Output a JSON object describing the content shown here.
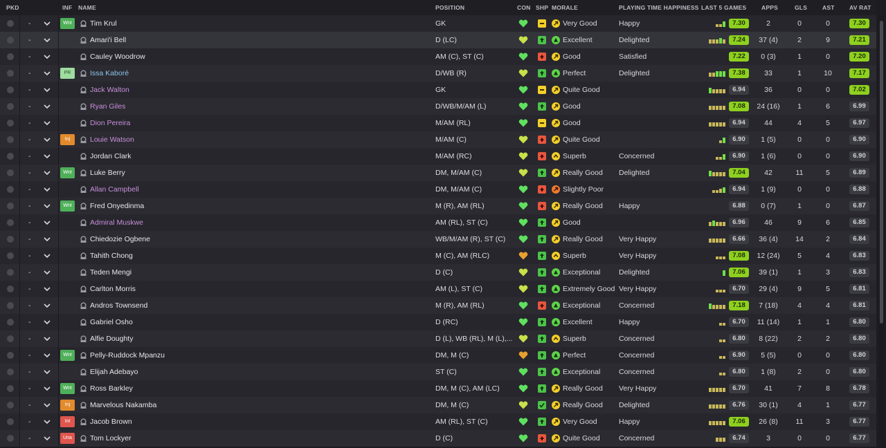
{
  "headers": {
    "pkd": "PKD",
    "inf": "INF",
    "name": "NAME",
    "position": "POSITION",
    "con": "CON",
    "shp": "SHP",
    "morale": "MORALE",
    "pth": "PLAYING TIME HAPPINESS",
    "last5": "LAST 5 GAMES",
    "apps": "APPS",
    "gls": "GLS",
    "ast": "AST",
    "avrat": "AV RAT"
  },
  "colors": {
    "rating_high": "#8ed01f",
    "rating_low": "#3b3b42",
    "heart_green": "#5fe05f",
    "heart_yellowgreen": "#c8e04a",
    "heart_orange": "#e8a030",
    "morale_good": "#f2cf2a",
    "morale_great": "#5fd34a",
    "morale_poor": "#f07a30",
    "inf_wnt": "#4fb05a",
    "inf_pr": "#9fdc9f",
    "inf_inj": "#e38a2c",
    "inf_int": "#e0564e"
  },
  "players": [
    {
      "pkd": "-",
      "inf": "Wnt",
      "name": "Tim Krul",
      "style": "normal",
      "pos": "GK",
      "con": "green",
      "shp": "yellow-dash",
      "morale_icon": "good",
      "morale": "Very Good",
      "pth": "Happy",
      "last5": [
        "short",
        "short",
        "tall"
      ],
      "last5_rating": "7.30",
      "last5_hi": true,
      "apps": "2",
      "gls": "0",
      "ast": "0",
      "avrat": "7.30",
      "avrat_hi": true
    },
    {
      "pkd": "-",
      "inf": "",
      "name": "Amari'i Bell",
      "style": "normal",
      "pos": "D (LC)",
      "con": "yellowgreen",
      "shp": "green-up",
      "morale_icon": "great",
      "morale": "Excellent",
      "pth": "Delighted",
      "last5": [
        "mid",
        "mid",
        "mid",
        "tall",
        "mid"
      ],
      "last5_rating": "7.24",
      "last5_hi": true,
      "apps": "37 (4)",
      "gls": "2",
      "ast": "9",
      "avrat": "7.21",
      "avrat_hi": true
    },
    {
      "pkd": "-",
      "inf": "",
      "name": "Cauley Woodrow",
      "style": "normal",
      "pos": "AM (C), ST (C)",
      "con": "green",
      "shp": "red-up",
      "morale_icon": "good",
      "morale": "Good",
      "pth": "Satisfied",
      "last5": [],
      "last5_rating": "7.22",
      "last5_hi": true,
      "apps": "0 (3)",
      "gls": "1",
      "ast": "0",
      "avrat": "7.20",
      "avrat_hi": true
    },
    {
      "pkd": "-",
      "inf": "PR",
      "name": "Issa Kaboré",
      "style": "blue",
      "pos": "D/WB (R)",
      "con": "yellowgreen",
      "shp": "green-up",
      "morale_icon": "great",
      "morale": "Perfect",
      "pth": "Delighted",
      "last5": [
        "mid",
        "mid",
        "tall",
        "tall",
        "tall"
      ],
      "last5_rating": "7.38",
      "last5_hi": true,
      "apps": "33",
      "gls": "1",
      "ast": "10",
      "avrat": "7.17",
      "avrat_hi": true
    },
    {
      "pkd": "-",
      "inf": "",
      "name": "Jack Walton",
      "style": "loan",
      "pos": "GK",
      "con": "green",
      "shp": "yellow-dash",
      "morale_icon": "good",
      "morale": "Quite Good",
      "pth": "",
      "last5": [
        "tall",
        "mid",
        "mid",
        "mid",
        "mid"
      ],
      "last5_rating": "6.94",
      "last5_hi": false,
      "apps": "36",
      "gls": "0",
      "ast": "0",
      "avrat": "7.02",
      "avrat_hi": true
    },
    {
      "pkd": "-",
      "inf": "",
      "name": "Ryan Giles",
      "style": "loan",
      "pos": "D/WB/M/AM (L)",
      "con": "green",
      "shp": "green-up",
      "morale_icon": "good",
      "morale": "Good",
      "pth": "",
      "last5": [
        "mid",
        "mid",
        "mid",
        "mid",
        "mid"
      ],
      "last5_rating": "7.08",
      "last5_hi": true,
      "apps": "24 (16)",
      "gls": "1",
      "ast": "6",
      "avrat": "6.99",
      "avrat_hi": false
    },
    {
      "pkd": "-",
      "inf": "",
      "name": "Dion Pereira",
      "style": "loan",
      "pos": "M/AM (RL)",
      "con": "green",
      "shp": "yellow-dash",
      "morale_icon": "good",
      "morale": "Good",
      "pth": "",
      "last5": [
        "mid",
        "mid",
        "mid",
        "mid",
        "mid"
      ],
      "last5_rating": "6.94",
      "last5_hi": false,
      "apps": "44",
      "gls": "4",
      "ast": "5",
      "avrat": "6.97",
      "avrat_hi": false
    },
    {
      "pkd": "-",
      "inf": "Inj",
      "name": "Louie Watson",
      "style": "loan",
      "pos": "M/AM (C)",
      "con": "yellowgreen",
      "shp": "red-up",
      "morale_icon": "good",
      "morale": "Quite Good",
      "pth": "",
      "last5": [
        "short",
        "tall"
      ],
      "last5_rating": "6.90",
      "last5_hi": false,
      "apps": "1 (5)",
      "gls": "0",
      "ast": "0",
      "avrat": "6.90",
      "avrat_hi": false
    },
    {
      "pkd": "-",
      "inf": "",
      "name": "Jordan Clark",
      "style": "normal",
      "pos": "M/AM (RC)",
      "con": "yellowgreen",
      "shp": "red-up",
      "morale_icon": "superb",
      "morale": "Superb",
      "pth": "Concerned",
      "last5": [
        "short",
        "short",
        "tall"
      ],
      "last5_rating": "6.90",
      "last5_hi": false,
      "apps": "1 (6)",
      "gls": "0",
      "ast": "0",
      "avrat": "6.90",
      "avrat_hi": false
    },
    {
      "pkd": "-",
      "inf": "Wnt",
      "name": "Luke Berry",
      "style": "normal",
      "pos": "DM, M/AM (C)",
      "con": "yellowgreen",
      "shp": "green-up",
      "morale_icon": "good",
      "morale": "Really Good",
      "pth": "Delighted",
      "last5": [
        "tall",
        "mid",
        "mid",
        "mid",
        "mid"
      ],
      "last5_rating": "7.04",
      "last5_hi": true,
      "apps": "42",
      "gls": "11",
      "ast": "5",
      "avrat": "6.89",
      "avrat_hi": false
    },
    {
      "pkd": "-",
      "inf": "",
      "name": "Allan Campbell",
      "style": "loan",
      "pos": "DM, M/AM (C)",
      "con": "green",
      "shp": "red-up",
      "morale_icon": "poor",
      "morale": "Slightly Poor",
      "pth": "",
      "last5": [
        "short",
        "short",
        "mid",
        "tall"
      ],
      "last5_rating": "6.94",
      "last5_hi": false,
      "apps": "1 (9)",
      "gls": "0",
      "ast": "0",
      "avrat": "6.88",
      "avrat_hi": false
    },
    {
      "pkd": "-",
      "inf": "Wnt",
      "name": "Fred Onyedinma",
      "style": "normal",
      "pos": "M (R), AM (RL)",
      "con": "green",
      "shp": "red-up",
      "morale_icon": "good",
      "morale": "Really Good",
      "pth": "Happy",
      "last5": [],
      "last5_rating": "6.88",
      "last5_hi": false,
      "apps": "0 (7)",
      "gls": "1",
      "ast": "0",
      "avrat": "6.87",
      "avrat_hi": false
    },
    {
      "pkd": "-",
      "inf": "",
      "name": "Admiral Muskwe",
      "style": "loan",
      "pos": "AM (RL), ST (C)",
      "con": "green",
      "shp": "green-up",
      "morale_icon": "good",
      "morale": "Good",
      "pth": "",
      "last5": [
        "mid",
        "tall",
        "mid",
        "mid",
        "mid"
      ],
      "last5_rating": "6.96",
      "last5_hi": false,
      "apps": "46",
      "gls": "9",
      "ast": "6",
      "avrat": "6.85",
      "avrat_hi": false
    },
    {
      "pkd": "-",
      "inf": "",
      "name": "Chiedozie Ogbene",
      "style": "normal",
      "pos": "WB/M/AM (R), ST (C)",
      "con": "green",
      "shp": "green-up",
      "morale_icon": "good",
      "morale": "Really Good",
      "pth": "Very Happy",
      "last5": [
        "mid",
        "mid",
        "mid",
        "mid",
        "mid"
      ],
      "last5_rating": "6.66",
      "last5_hi": false,
      "apps": "36 (4)",
      "gls": "14",
      "ast": "2",
      "avrat": "6.84",
      "avrat_hi": false
    },
    {
      "pkd": "-",
      "inf": "",
      "name": "Tahith Chong",
      "style": "normal",
      "pos": "M (C), AM (RLC)",
      "con": "orange",
      "shp": "green-up",
      "morale_icon": "superb",
      "morale": "Superb",
      "pth": "Very Happy",
      "last5": [
        "short",
        "short",
        "short"
      ],
      "last5_rating": "7.08",
      "last5_hi": true,
      "apps": "12 (24)",
      "gls": "5",
      "ast": "4",
      "avrat": "6.83",
      "avrat_hi": false
    },
    {
      "pkd": "-",
      "inf": "",
      "name": "Teden Mengi",
      "style": "normal",
      "pos": "D (C)",
      "con": "yellowgreen",
      "shp": "green-up",
      "morale_icon": "great",
      "morale": "Exceptional",
      "pth": "Delighted",
      "last5": [
        "tall"
      ],
      "last5_rating": "7.06",
      "last5_hi": true,
      "apps": "39 (1)",
      "gls": "1",
      "ast": "3",
      "avrat": "6.83",
      "avrat_hi": false
    },
    {
      "pkd": "-",
      "inf": "",
      "name": "Carlton Morris",
      "style": "normal",
      "pos": "AM (L), ST (C)",
      "con": "yellowgreen",
      "shp": "green-up",
      "morale_icon": "great",
      "morale": "Extremely Good",
      "pth": "Very Happy",
      "last5": [
        "short",
        "short",
        "short"
      ],
      "last5_rating": "6.70",
      "last5_hi": false,
      "apps": "29 (4)",
      "gls": "9",
      "ast": "5",
      "avrat": "6.81",
      "avrat_hi": false
    },
    {
      "pkd": "-",
      "inf": "",
      "name": "Andros Townsend",
      "style": "normal",
      "pos": "M (R), AM (RL)",
      "con": "green",
      "shp": "red-up",
      "morale_icon": "great",
      "morale": "Exceptional",
      "pth": "Concerned",
      "last5": [
        "tall",
        "mid",
        "mid",
        "mid",
        "mid"
      ],
      "last5_rating": "7.18",
      "last5_hi": true,
      "apps": "7 (18)",
      "gls": "4",
      "ast": "4",
      "avrat": "6.81",
      "avrat_hi": false
    },
    {
      "pkd": "-",
      "inf": "",
      "name": "Gabriel Osho",
      "style": "normal",
      "pos": "D (RC)",
      "con": "green",
      "shp": "green-up",
      "morale_icon": "great",
      "morale": "Excellent",
      "pth": "Happy",
      "last5": [
        "short",
        "short"
      ],
      "last5_rating": "6.70",
      "last5_hi": false,
      "apps": "11 (14)",
      "gls": "1",
      "ast": "1",
      "avrat": "6.80",
      "avrat_hi": false
    },
    {
      "pkd": "-",
      "inf": "",
      "name": "Alfie Doughty",
      "style": "normal",
      "pos": "D (L), WB (RL), M (L),...",
      "con": "yellowgreen",
      "shp": "green-up",
      "morale_icon": "superb",
      "morale": "Superb",
      "pth": "Concerned",
      "last5": [
        "short",
        "short"
      ],
      "last5_rating": "6.80",
      "last5_hi": false,
      "apps": "8 (22)",
      "gls": "2",
      "ast": "2",
      "avrat": "6.80",
      "avrat_hi": false
    },
    {
      "pkd": "-",
      "inf": "Wnt",
      "name": "Pelly-Ruddock Mpanzu",
      "style": "normal",
      "pos": "DM, M (C)",
      "con": "orange",
      "shp": "green-up",
      "morale_icon": "great",
      "morale": "Perfect",
      "pth": "Concerned",
      "last5": [
        "short",
        "short"
      ],
      "last5_rating": "6.90",
      "last5_hi": false,
      "apps": "5 (5)",
      "gls": "0",
      "ast": "0",
      "avrat": "6.80",
      "avrat_hi": false
    },
    {
      "pkd": "-",
      "inf": "",
      "name": "Elijah Adebayo",
      "style": "normal",
      "pos": "ST (C)",
      "con": "green",
      "shp": "green-up",
      "morale_icon": "great",
      "morale": "Exceptional",
      "pth": "Concerned",
      "last5": [
        "short",
        "short"
      ],
      "last5_rating": "6.80",
      "last5_hi": false,
      "apps": "1 (8)",
      "gls": "2",
      "ast": "0",
      "avrat": "6.80",
      "avrat_hi": false
    },
    {
      "pkd": "-",
      "inf": "Wnt",
      "name": "Ross Barkley",
      "style": "normal",
      "pos": "DM, M (C), AM (LC)",
      "con": "green",
      "shp": "green-up",
      "morale_icon": "good",
      "morale": "Really Good",
      "pth": "Very Happy",
      "last5": [
        "mid",
        "mid",
        "mid",
        "mid",
        "mid"
      ],
      "last5_rating": "6.70",
      "last5_hi": false,
      "apps": "41",
      "gls": "7",
      "ast": "8",
      "avrat": "6.78",
      "avrat_hi": false
    },
    {
      "pkd": "-",
      "inf": "Inj",
      "name": "Marvelous Nakamba",
      "style": "normal",
      "pos": "DM, M (C)",
      "con": "yellowgreen",
      "shp": "green-check",
      "morale_icon": "good",
      "morale": "Really Good",
      "pth": "Delighted",
      "last5": [
        "mid",
        "mid",
        "mid",
        "mid",
        "mid"
      ],
      "last5_rating": "6.76",
      "last5_hi": false,
      "apps": "30 (1)",
      "gls": "4",
      "ast": "1",
      "avrat": "6.77",
      "avrat_hi": false
    },
    {
      "pkd": "-",
      "inf": "Int",
      "name": "Jacob Brown",
      "style": "normal",
      "pos": "AM (RL), ST (C)",
      "con": "green",
      "shp": "green-up",
      "morale_icon": "good",
      "morale": "Very Good",
      "pth": "Happy",
      "last5": [
        "mid",
        "mid",
        "mid",
        "mid",
        "mid"
      ],
      "last5_rating": "7.06",
      "last5_hi": true,
      "apps": "26 (8)",
      "gls": "11",
      "ast": "3",
      "avrat": "6.77",
      "avrat_hi": false
    },
    {
      "pkd": "-",
      "inf": "Una",
      "name": "Tom Lockyer",
      "style": "normal",
      "pos": "D (C)",
      "con": "green",
      "shp": "red-up",
      "morale_icon": "good",
      "morale": "Quite Good",
      "pth": "Concerned",
      "last5": [
        "mid",
        "mid",
        "mid"
      ],
      "last5_rating": "6.74",
      "last5_hi": false,
      "apps": "3",
      "gls": "0",
      "ast": "0",
      "avrat": "6.77",
      "avrat_hi": false
    }
  ]
}
